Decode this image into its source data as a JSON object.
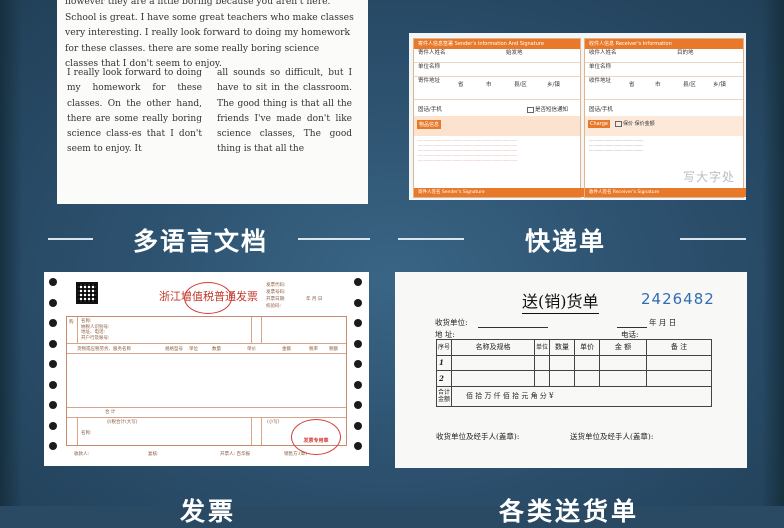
{
  "sections": {
    "doc_label": "多语言文档",
    "express_label": "快递单",
    "invoice_label": "发票",
    "delivery_label": "各类送货单"
  },
  "doc": {
    "top_text": "however they are a little boring because you aren't here. School is great. I have some great teachers who make classes very interesting. I really look forward to doing my homework for these classes. there are some really boring science classes that I don't seem to enjoy.",
    "col_left": "I really look forward to doing my homework for these classes. On the other hand, there are some really boring science class-es that I don't seem to enjoy. It",
    "col_right": "all sounds so difficult, but I have to sit in the classroom. The good thing is that all the friends I've made don't like science classes, The good thing is that all the"
  },
  "express": {
    "sender_head": "寄件人信息签署 Sender's Information And Signature",
    "receiver_head": "收件人信息 Receiver's Information",
    "sender_name": "寄件人姓名",
    "sender_origin": "始发地",
    "receiver_name": "收件人姓名",
    "receiver_dest": "目的地",
    "company": "单位名称",
    "address": "寄件地址",
    "receiver_address": "收件地址",
    "province": "省",
    "city": "市",
    "county": "县/区",
    "town": "乡/镇",
    "phone": "固话/手机",
    "sms_notice": "是否短信通知",
    "package_info": "物品信息",
    "pay_options": "保价 保价金额",
    "sender_sign": "寄件人签名 Sender's Signature",
    "receiver_sign": "收件人签名 Receiver's Signature",
    "big_text": "写大字处"
  },
  "invoice": {
    "title": "浙江增值税普通发票",
    "stamp_bottom_text": "发票专用章",
    "meta_lines": [
      "发票代码:",
      "发票号码:",
      "开票日期:",
      "校验码:"
    ],
    "date_fields": "年  月  日",
    "buyer_block": [
      "购",
      "名称:",
      "纳税人识别号:",
      "地址、电话:",
      "开户行及账号:"
    ],
    "column_headers": [
      "货物或应税劳务、服务名称",
      "规格型号",
      "单位",
      "数量",
      "单价",
      "金额",
      "税率",
      "税额"
    ],
    "total_row": "合    计",
    "total_in_words": "价税合计(大写)",
    "lowercase_total": "(小写)",
    "payee": "收款人:",
    "reviewer": "复核:",
    "issuer": "开票人: 百华报",
    "seller": "销售方:(章)"
  },
  "delivery": {
    "title": "送(销)货单",
    "number": "2426482",
    "receiver_unit": "收货单位:",
    "address": "地    址:",
    "phone": "电话:",
    "date": "年    月    日",
    "headers": [
      "序号",
      "名称及规格",
      "单位",
      "数量",
      "单价",
      "金    额",
      "备  注"
    ],
    "rows": [
      "1",
      "2"
    ],
    "total_label": "合计金额",
    "total_text": "佰  拾  万  仟  佰  拾  元  角  分  ¥",
    "sign_receiver": "收货单位及经手人(盖章):",
    "sign_sender": "送货单位及经手人(盖章):"
  }
}
